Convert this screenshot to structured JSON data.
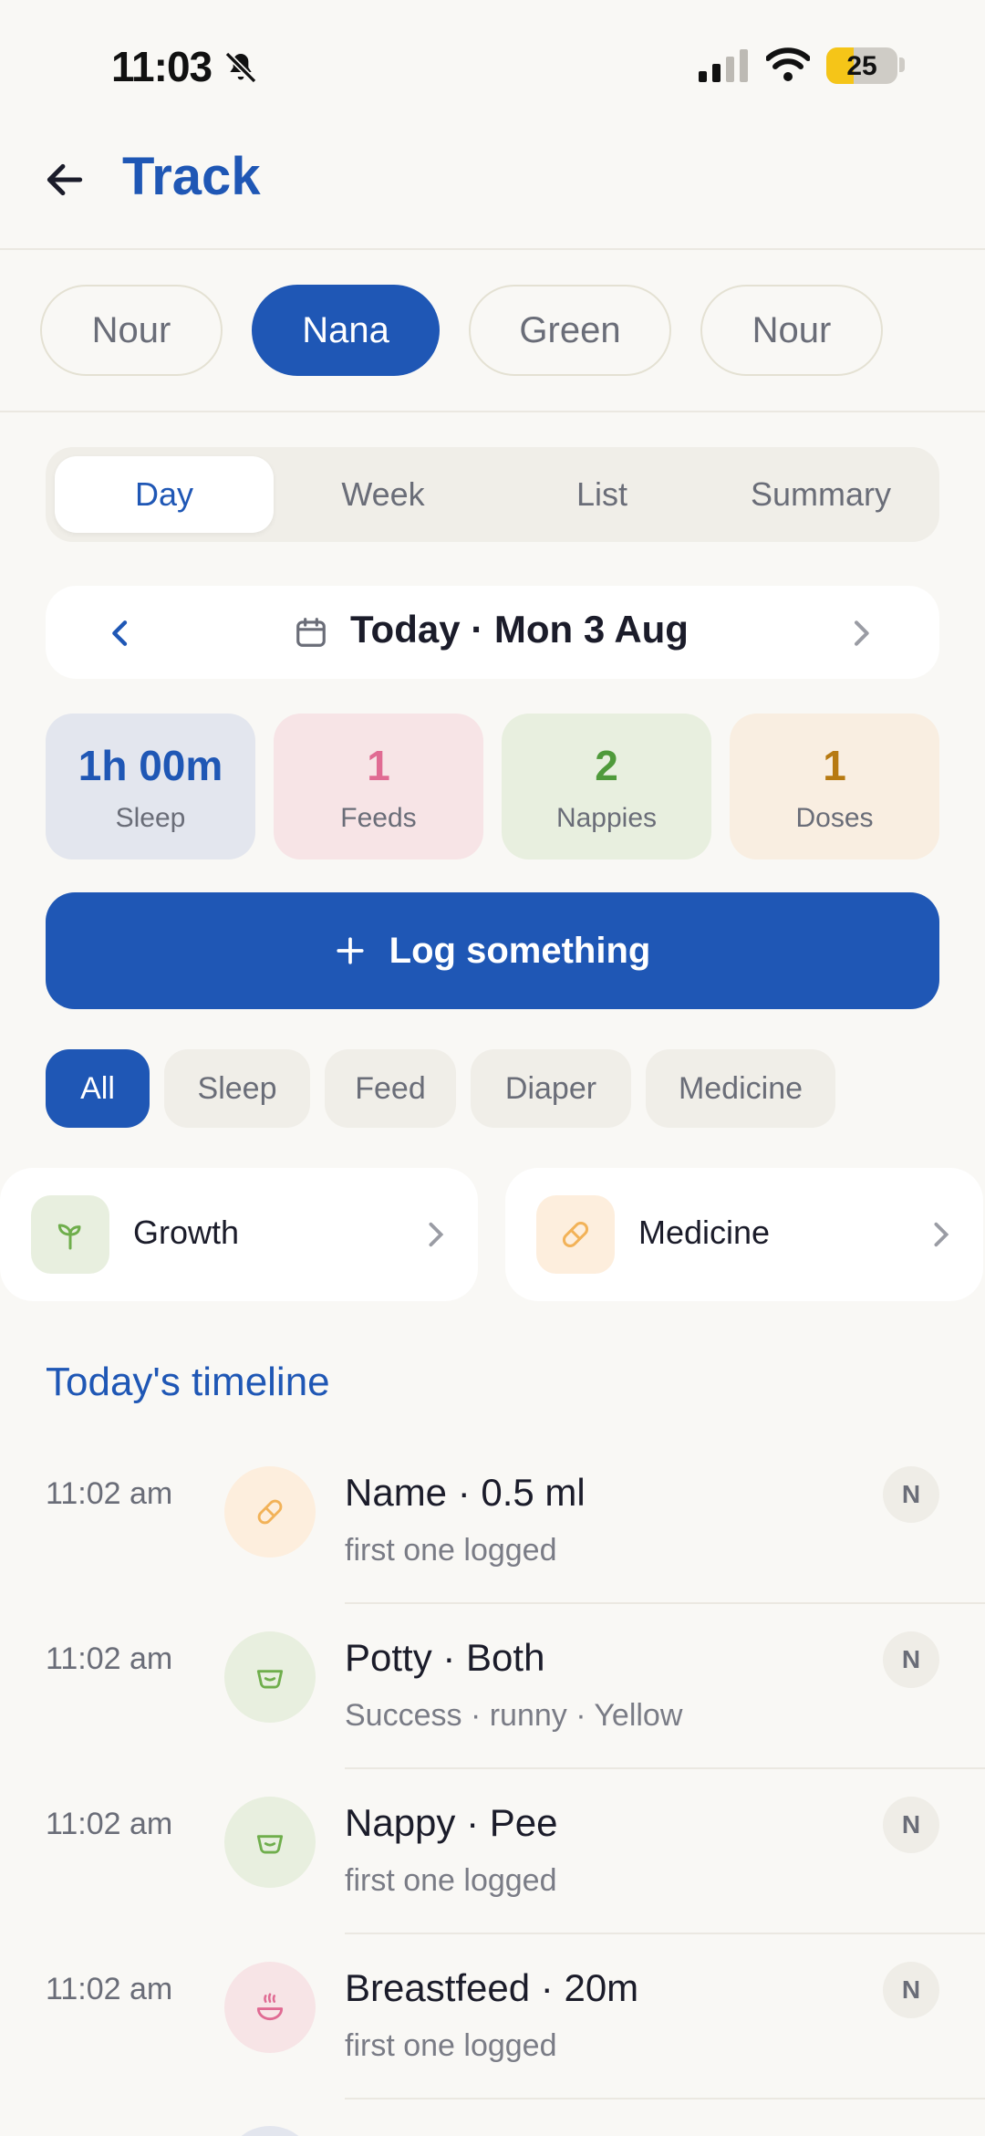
{
  "status_bar": {
    "time": "11:03",
    "battery": "25"
  },
  "header": {
    "title": "Track"
  },
  "children": [
    "Nour",
    "Nana",
    "Green",
    "Nour"
  ],
  "active_child_index": 1,
  "view_tabs": [
    "Day",
    "Week",
    "List",
    "Summary"
  ],
  "active_view_index": 0,
  "date_nav": {
    "label": "Today · Mon 3 Aug"
  },
  "stats": [
    {
      "value": "1h 00m",
      "label": "Sleep",
      "color": "#1f57b5",
      "bg": "#e3e6ee"
    },
    {
      "value": "1",
      "label": "Feeds",
      "color": "#e06b93",
      "bg": "#f7e4e6"
    },
    {
      "value": "2",
      "label": "Nappies",
      "color": "#4f9a3b",
      "bg": "#e8efdf"
    },
    {
      "value": "1",
      "label": "Doses",
      "color": "#b77a12",
      "bg": "#f9eee1"
    }
  ],
  "log_button": {
    "label": "Log something"
  },
  "filters": [
    "All",
    "Sleep",
    "Feed",
    "Diaper",
    "Medicine"
  ],
  "active_filter_index": 0,
  "shortcuts": [
    {
      "label": "Growth",
      "icon": "sprout-icon",
      "icon_bg": "#e8efdf",
      "icon_color": "#6fae4c"
    },
    {
      "label": "Medicine",
      "icon": "pill-icon",
      "icon_bg": "#fdeedd",
      "icon_color": "#f2b258"
    }
  ],
  "timeline": {
    "heading": "Today's timeline",
    "entries": [
      {
        "time": "11:02 am",
        "title": "Name · 0.5 ml",
        "subtitle": "first one logged",
        "icon": "pill-icon",
        "icon_bg": "#fdeedd",
        "icon_color": "#f2b258",
        "badge": "N"
      },
      {
        "time": "11:02 am",
        "title": "Potty · Both",
        "subtitle": "Success · runny · Yellow",
        "icon": "potty-icon",
        "icon_bg": "#e8efdf",
        "icon_color": "#6fae4c",
        "badge": "N"
      },
      {
        "time": "11:02 am",
        "title": "Nappy · Pee",
        "subtitle": "first one logged",
        "icon": "potty-icon",
        "icon_bg": "#e8efdf",
        "icon_color": "#6fae4c",
        "badge": "N"
      },
      {
        "time": "11:02 am",
        "title": "Breastfeed · 20m",
        "subtitle": "first one logged",
        "icon": "bowl-icon",
        "icon_bg": "#f7e4e6",
        "icon_color": "#e06b93",
        "badge": "N"
      }
    ]
  }
}
